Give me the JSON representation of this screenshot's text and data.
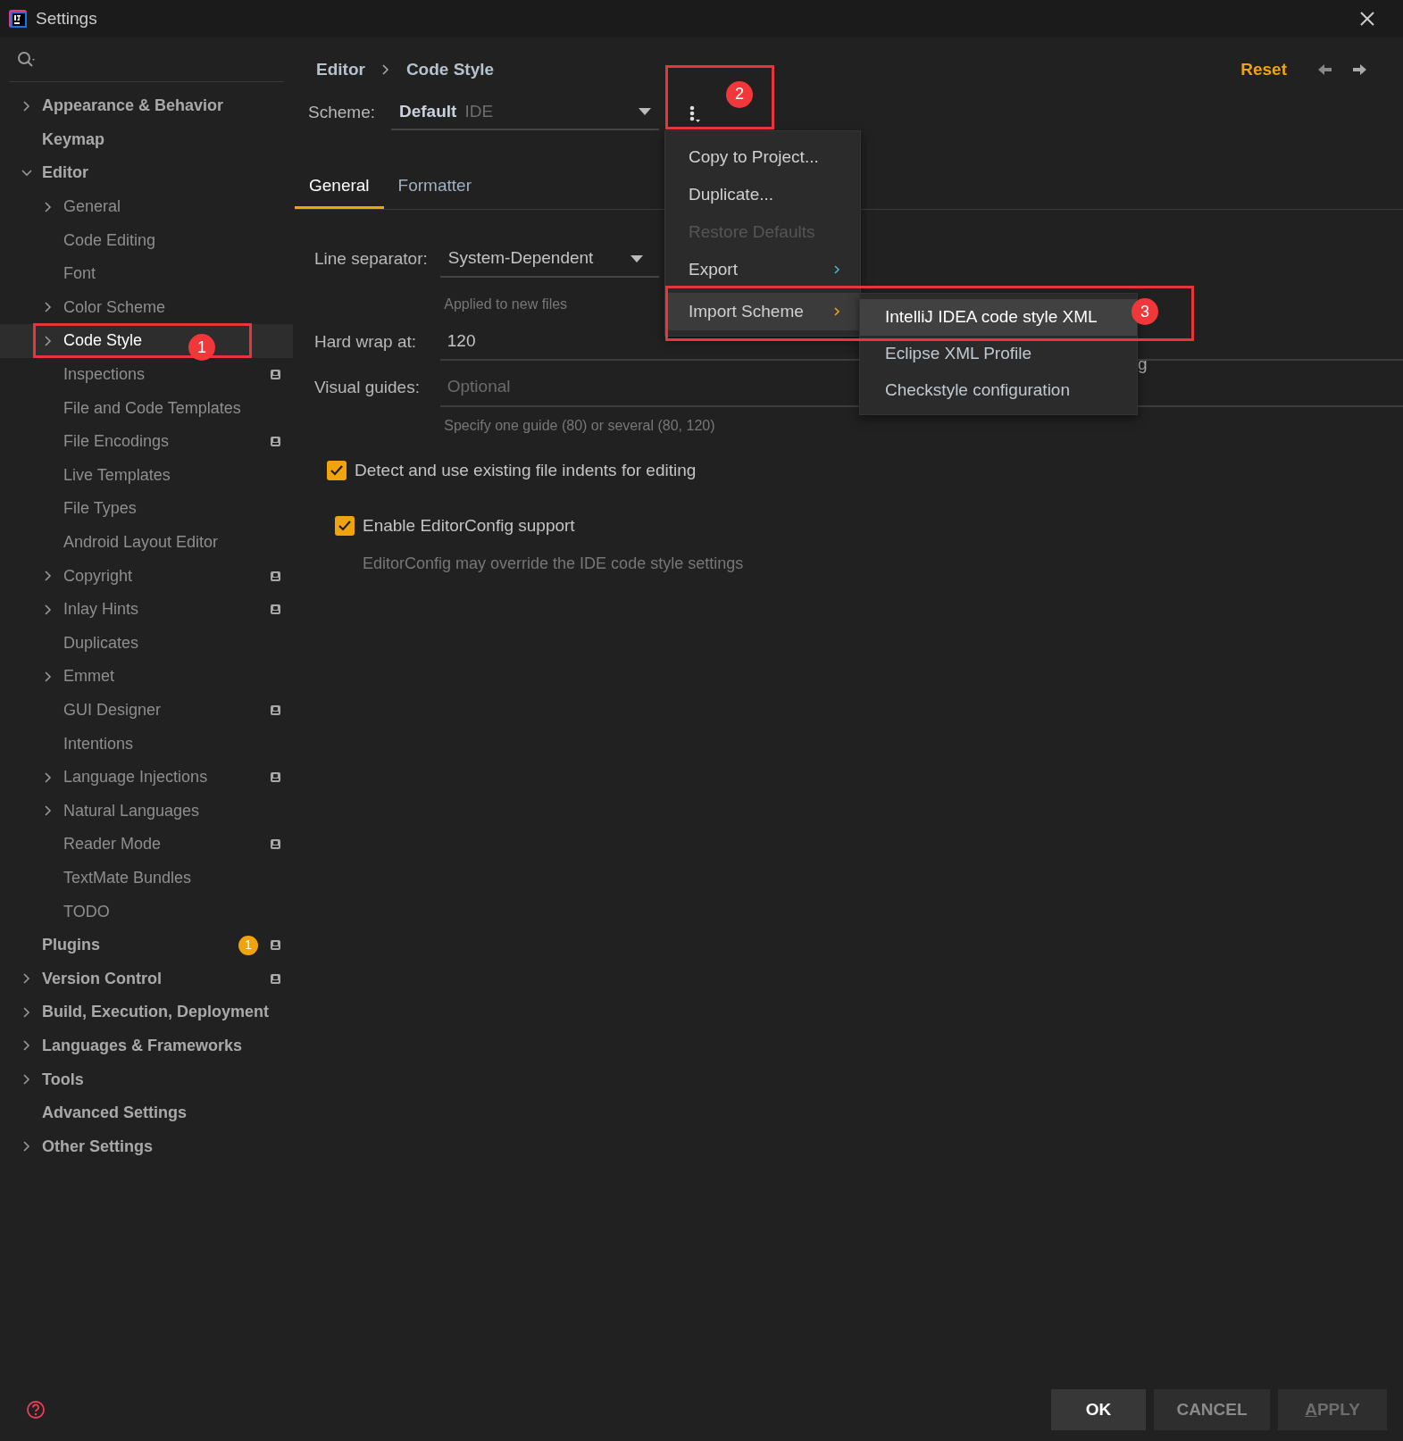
{
  "window": {
    "title": "Settings"
  },
  "sidebar": {
    "items": [
      {
        "label": "Appearance & Behavior",
        "expanded": false,
        "selected": false
      },
      {
        "label": "Keymap",
        "selected": false
      },
      {
        "label": "Editor",
        "expanded": true,
        "selected": false,
        "children": [
          {
            "label": "General",
            "expanded": false,
            "selected": false
          },
          {
            "label": "Code Editing",
            "selected": false
          },
          {
            "label": "Font",
            "selected": false
          },
          {
            "label": "Color Scheme",
            "expanded": false,
            "selected": false
          },
          {
            "label": "Code Style",
            "expanded": false,
            "selected": true,
            "annotation": "1"
          },
          {
            "label": "Inspections",
            "selected": false,
            "project_scope": true
          },
          {
            "label": "File and Code Templates",
            "selected": false
          },
          {
            "label": "File Encodings",
            "selected": false,
            "project_scope": true
          },
          {
            "label": "Live Templates",
            "selected": false
          },
          {
            "label": "File Types",
            "selected": false
          },
          {
            "label": "Android Layout Editor",
            "selected": false
          },
          {
            "label": "Copyright",
            "expanded": false,
            "selected": false,
            "project_scope": true
          },
          {
            "label": "Inlay Hints",
            "expanded": false,
            "selected": false,
            "project_scope": true
          },
          {
            "label": "Duplicates",
            "selected": false
          },
          {
            "label": "Emmet",
            "expanded": false,
            "selected": false
          },
          {
            "label": "GUI Designer",
            "selected": false,
            "project_scope": true
          },
          {
            "label": "Intentions",
            "selected": false
          },
          {
            "label": "Language Injections",
            "expanded": false,
            "selected": false,
            "project_scope": true
          },
          {
            "label": "Natural Languages",
            "expanded": false,
            "selected": false
          },
          {
            "label": "Reader Mode",
            "selected": false,
            "project_scope": true
          },
          {
            "label": "TextMate Bundles",
            "selected": false
          },
          {
            "label": "TODO",
            "selected": false
          }
        ]
      },
      {
        "label": "Plugins",
        "selected": false,
        "badge": "1",
        "project_scope": true
      },
      {
        "label": "Version Control",
        "expanded": false,
        "selected": false,
        "project_scope": true
      },
      {
        "label": "Build, Execution, Deployment",
        "expanded": false,
        "selected": false
      },
      {
        "label": "Languages & Frameworks",
        "expanded": false,
        "selected": false
      },
      {
        "label": "Tools",
        "expanded": false,
        "selected": false
      },
      {
        "label": "Advanced Settings",
        "selected": false
      },
      {
        "label": "Other Settings",
        "expanded": false,
        "selected": false
      }
    ]
  },
  "breadcrumb": [
    "Editor",
    "Code Style"
  ],
  "reset": "Reset",
  "scheme": {
    "label": "Scheme:",
    "name": "Default",
    "type": "IDE",
    "menu_annotation": "2"
  },
  "tabs": [
    {
      "label": "General",
      "selected": true
    },
    {
      "label": "Formatter",
      "selected": false
    }
  ],
  "form": {
    "line_separator": {
      "label": "Line separator:",
      "value": "System-Dependent",
      "hint": "Applied to new files"
    },
    "hard_wrap": {
      "label": "Hard wrap at:",
      "value": "120",
      "side_text": "g"
    },
    "visual_guides": {
      "label": "Visual guides:",
      "placeholder": "Optional",
      "hint": "Specify one guide (80) or several (80, 120)"
    },
    "checkboxes": [
      {
        "label": "Detect and use existing file indents for editing",
        "checked": true
      },
      {
        "label": "Enable EditorConfig support",
        "checked": true,
        "note": "EditorConfig may override the IDE code style settings"
      }
    ]
  },
  "menu": {
    "items": [
      {
        "label": "Copy to Project...",
        "disabled": false,
        "submenu": false,
        "selected": false
      },
      {
        "label": "Duplicate...",
        "disabled": false,
        "submenu": false,
        "selected": false
      },
      {
        "label": "Restore Defaults",
        "disabled": true,
        "submenu": false,
        "selected": false
      },
      {
        "label": "Export",
        "disabled": false,
        "submenu": true,
        "selected": false
      },
      {
        "label": "Import Scheme",
        "disabled": false,
        "submenu": true,
        "selected": true,
        "annotation": "3"
      }
    ],
    "submenu": [
      {
        "label": "IntelliJ IDEA code style XML",
        "selected": true
      },
      {
        "label": "Eclipse XML Profile",
        "selected": false
      },
      {
        "label": "Checkstyle configuration",
        "selected": false
      }
    ]
  },
  "footer": {
    "buttons": [
      {
        "label": "OK",
        "kind": "default",
        "disabled": false
      },
      {
        "label": "CANCEL",
        "kind": "normal",
        "disabled": false
      },
      {
        "label": "APPLY",
        "kind": "normal",
        "disabled": true,
        "mnemonic": true
      }
    ]
  }
}
